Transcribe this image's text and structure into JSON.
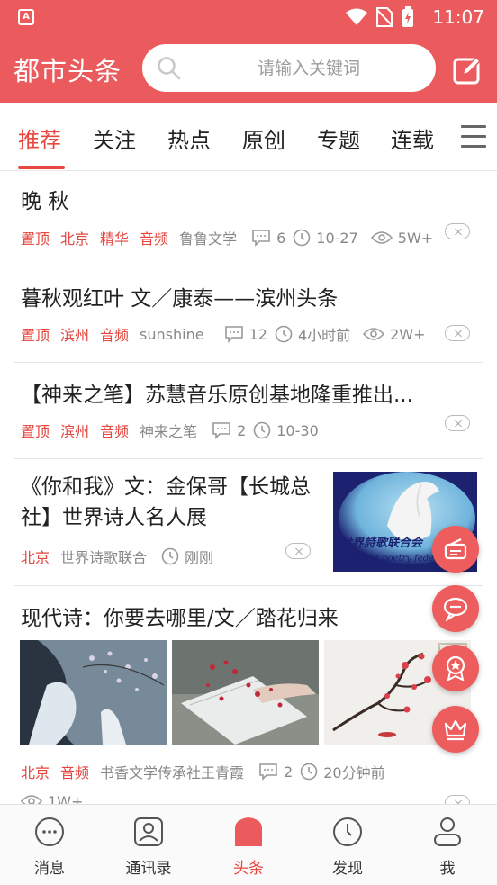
{
  "status_bar": {
    "time": "11:07"
  },
  "header": {
    "app_title": "都市头条",
    "search_placeholder": "请输入关键词"
  },
  "tabs": [
    "推荐",
    "关注",
    "热点",
    "原创",
    "专题",
    "连载"
  ],
  "feed": [
    {
      "title": "晚 秋",
      "tags": [
        "置顶",
        "北京",
        "精华",
        "音频"
      ],
      "source": "鲁鲁文学",
      "comments": "6",
      "time": "10-27",
      "views": "5W+"
    },
    {
      "title": "暮秋观红叶 文／康泰——滨州头条",
      "tags": [
        "置顶",
        "滨州",
        "音频"
      ],
      "source": "sunshine",
      "comments": "12",
      "time": "4小时前",
      "views": "2W+"
    },
    {
      "title": "【神来之笔】苏慧音乐原创基地隆重推出...",
      "tags": [
        "置顶",
        "滨州",
        "音频"
      ],
      "source": "神来之笔",
      "comments": "2",
      "time": "10-30"
    },
    {
      "title": "《你和我》文：金保哥【长城总社】世界诗人名人展",
      "tags": [
        "北京"
      ],
      "source": "世界诗歌联合",
      "time": "刚刚",
      "image_caption": "世界诗歌联合会 world poetry feder"
    },
    {
      "title": "现代诗：你要去哪里/文／踏花归来",
      "tags": [
        "北京",
        "音频"
      ],
      "source": "书香文学传承社王青霞",
      "comments": "2",
      "time": "20分钟前",
      "views": "1W+"
    }
  ],
  "bottom_nav": [
    "消息",
    "通讯录",
    "头条",
    "发现",
    "我"
  ],
  "colors": {
    "brand_red": "#eb5b5e",
    "accent_red": "#e8473f"
  }
}
